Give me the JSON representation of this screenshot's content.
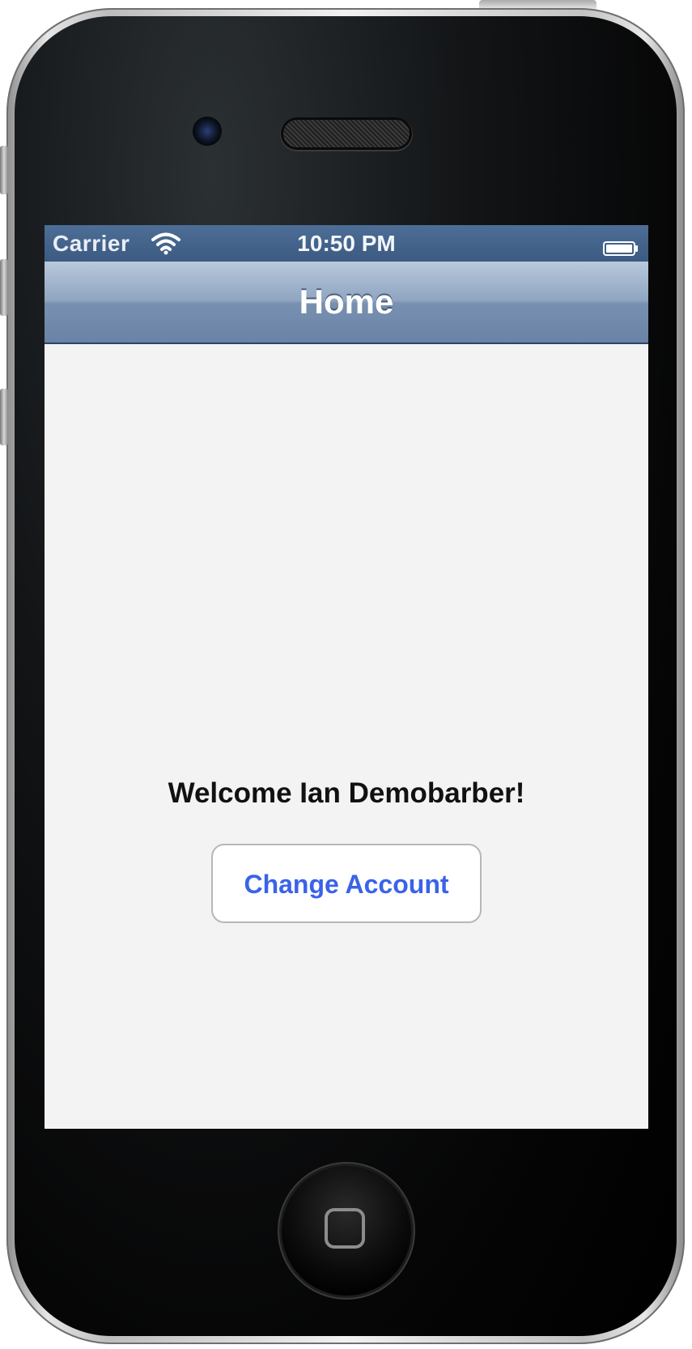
{
  "status_bar": {
    "carrier": "Carrier",
    "time": "10:50 PM",
    "wifi_icon": "wifi-icon",
    "battery_icon": "battery-icon"
  },
  "nav_bar": {
    "title": "Home"
  },
  "main": {
    "welcome_text": "Welcome Ian Demobarber!",
    "change_account_label": "Change Account"
  },
  "device": {
    "home_button_icon": "home-button-icon",
    "camera_icon": "camera-icon",
    "speaker_icon": "speaker-icon"
  },
  "colors": {
    "status_bar": "#3c5a82",
    "nav_bar": "#7890b0",
    "screen_background": "#f3f3f3",
    "button_text": "#3a63e8",
    "welcome_text": "#111111"
  }
}
